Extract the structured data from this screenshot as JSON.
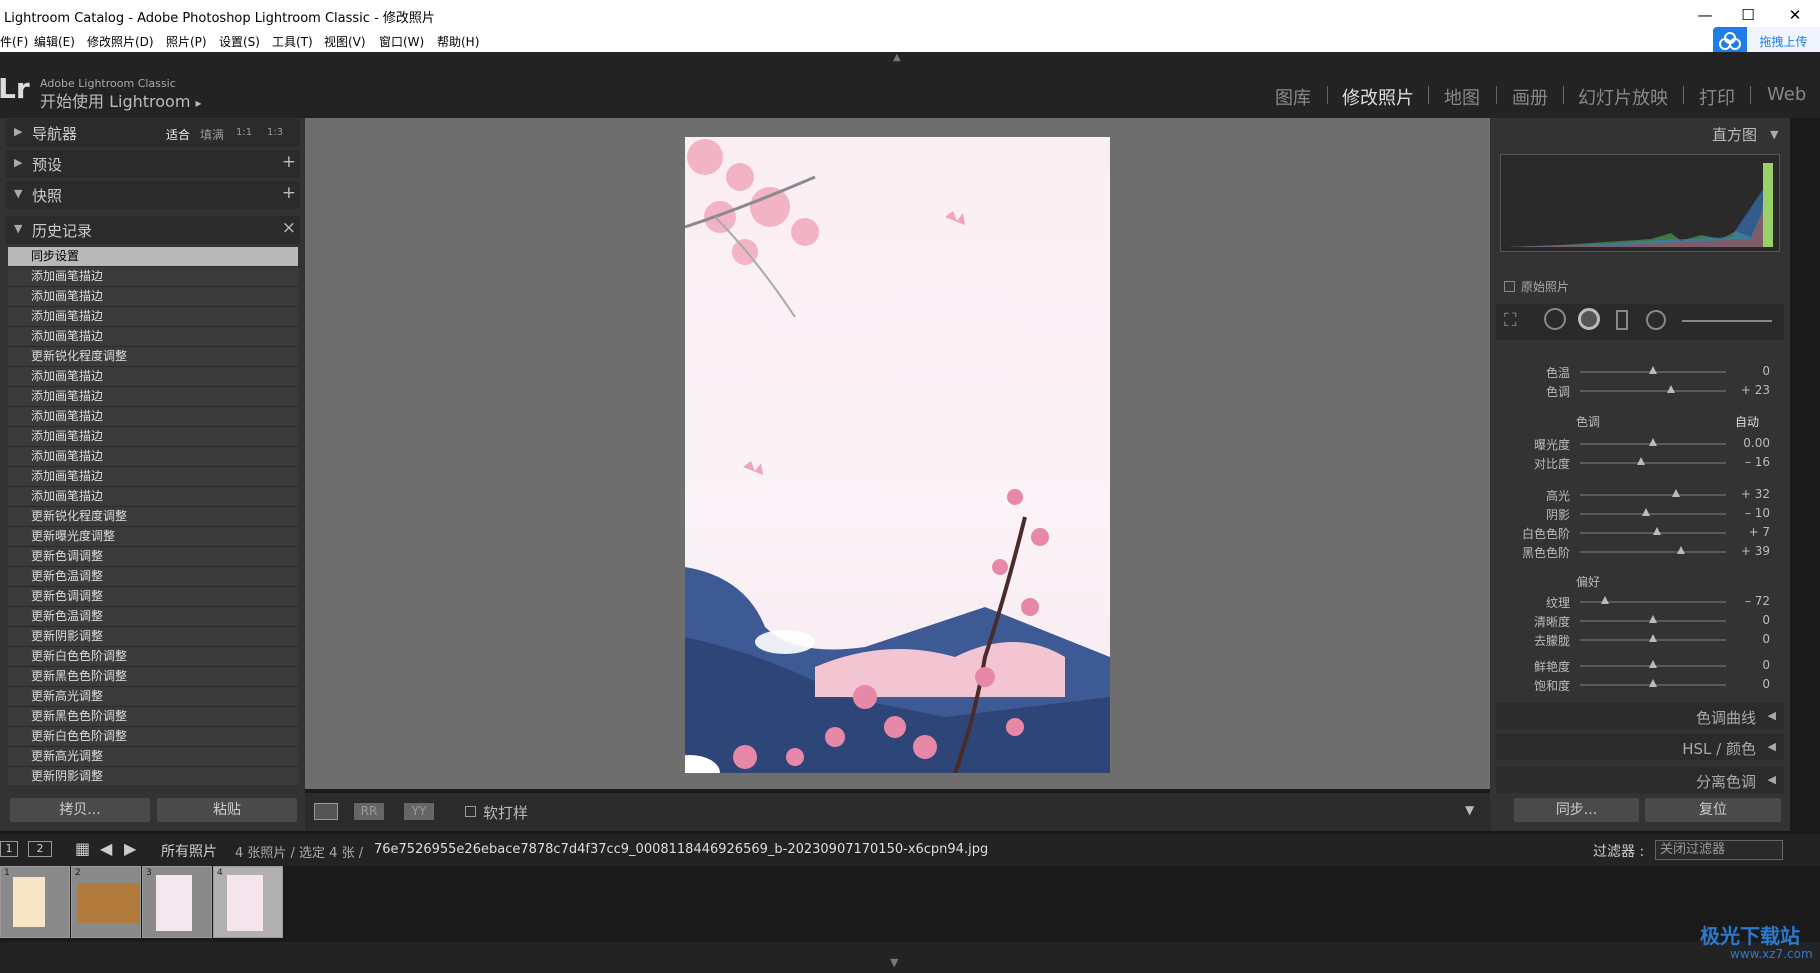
{
  "window": {
    "title": "Lightroom Catalog - Adobe Photoshop Lightroom Classic - 修改照片",
    "min": "—",
    "max": "☐",
    "close": "✕"
  },
  "menu": [
    "件(F)",
    "编辑(E)",
    "修改照片(D)",
    "照片(P)",
    "设置(S)",
    "工具(T)",
    "视图(V)",
    "窗口(W)",
    "帮助(H)"
  ],
  "cloud": {
    "label": "拖拽上传"
  },
  "identity": {
    "logo": "Lr",
    "small": "Adobe Lightroom Classic",
    "big": "开始使用 Lightroom",
    "arrow": "▸"
  },
  "modules": [
    "图库",
    "修改照片",
    "地图",
    "画册",
    "幻灯片放映",
    "打印",
    "Web"
  ],
  "left_panels": {
    "navigator": {
      "label": "导航器",
      "opts": [
        "适合",
        "填满",
        "1:1",
        "1:3"
      ]
    },
    "presets": {
      "label": "预设",
      "action": "+"
    },
    "snapshots": {
      "label": "快照",
      "action": "+"
    },
    "history": {
      "label": "历史记录",
      "action": "×",
      "items": [
        "同步设置",
        "添加画笔描边",
        "添加画笔描边",
        "添加画笔描边",
        "添加画笔描边",
        "更新锐化程度调整",
        "添加画笔描边",
        "添加画笔描边",
        "添加画笔描边",
        "添加画笔描边",
        "添加画笔描边",
        "添加画笔描边",
        "添加画笔描边",
        "更新锐化程度调整",
        "更新曝光度调整",
        "更新色调调整",
        "更新色温调整",
        "更新色调调整",
        "更新色温调整",
        "更新阴影调整",
        "更新白色色阶调整",
        "更新黑色色阶调整",
        "更新高光调整",
        "更新黑色色阶调整",
        "更新白色色阶调整",
        "更新高光调整",
        "更新阴影调整"
      ]
    },
    "copy": "拷贝...",
    "paste": "粘贴"
  },
  "toolbar": {
    "softproof": "软打样"
  },
  "right_panels": {
    "histogram": "直方图",
    "original_photo": "原始照片",
    "tone_label": "色调",
    "auto": "自动",
    "presence_label": "偏好",
    "sliders": [
      {
        "name": "色温",
        "value": "0",
        "pos": 0.5
      },
      {
        "name": "色调",
        "value": "+ 23",
        "pos": 0.62
      },
      {
        "name": "曝光度",
        "value": "0.00",
        "pos": 0.5
      },
      {
        "name": "对比度",
        "value": "– 16",
        "pos": 0.42
      },
      {
        "name": "高光",
        "value": "+ 32",
        "pos": 0.66
      },
      {
        "name": "阴影",
        "value": "– 10",
        "pos": 0.45
      },
      {
        "name": "白色色阶",
        "value": "+ 7",
        "pos": 0.53
      },
      {
        "name": "黑色色阶",
        "value": "+ 39",
        "pos": 0.69
      },
      {
        "name": "纹理",
        "value": "– 72",
        "pos": 0.17
      },
      {
        "name": "清晰度",
        "value": "0",
        "pos": 0.5
      },
      {
        "name": "去朦胧",
        "value": "0",
        "pos": 0.5
      },
      {
        "name": "鲜艳度",
        "value": "0",
        "pos": 0.5
      },
      {
        "name": "饱和度",
        "value": "0",
        "pos": 0.5
      }
    ],
    "tone_curve": "色调曲线",
    "hsl": "HSL / 颜色",
    "split": "分离色调",
    "sync": "同步...",
    "reset": "复位"
  },
  "filmstrip": {
    "view1": "1",
    "view2": "2",
    "source": "所有照片",
    "info": "4 张照片 / 选定 4 张 /",
    "filename": "76e7526955e26ebace7878c7d4f37cc9_0008118446926569_b-20230907170150-x6cpn94.jpg",
    "filter_label": "过滤器 :",
    "filter_value": "关闭过滤器",
    "thumbs": [
      "1",
      "2",
      "3",
      "4"
    ]
  },
  "watermark": {
    "big": "极光下载站",
    "small": "www.xz7.com"
  }
}
